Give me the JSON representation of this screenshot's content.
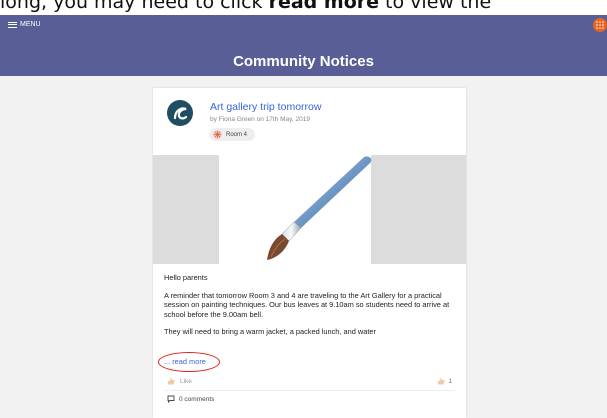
{
  "caption": {
    "before": "long, you may need to click ",
    "bold": "read more",
    "after": " to view the"
  },
  "topbar": {
    "menu_label": "MENU",
    "title": "Community Notices",
    "bg_color": "#5a5e96"
  },
  "post": {
    "title": "Art gallery trip tomorrow",
    "byline": "by Fiona Green on 17th May, 2019",
    "room_tag": "Room 4",
    "greeting": "Hello parents",
    "paragraph1": "A reminder that tomorrow Room 3 and 4 are traveling to the Art Gallery for a practical session on painting techniques. Our bus leaves at 9.10am so students need to arrive at school before the 9.00am bell.",
    "paragraph2": "They will need to bring a warm jacket, a packed lunch, and water",
    "read_more": "... read more",
    "like_label": "Like",
    "like_count": "1",
    "comments_label": "0 comments",
    "link_color": "#3a63d8",
    "highlight_color": "#d8241f"
  }
}
